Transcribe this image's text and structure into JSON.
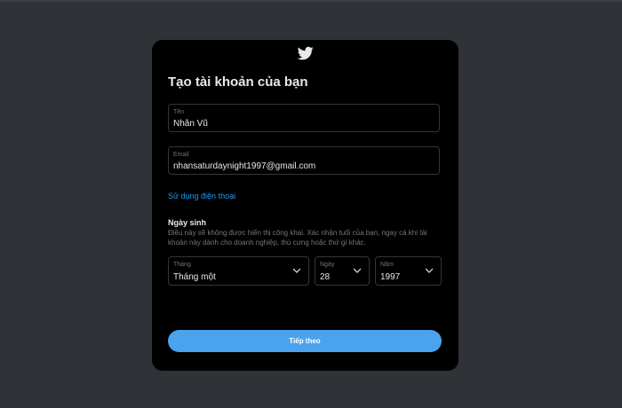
{
  "modal": {
    "logo_icon": "twitter-bird-icon",
    "title": "Tạo tài khoản của bạn"
  },
  "form": {
    "name": {
      "label": "Tên",
      "value": "Nhân Vũ"
    },
    "email": {
      "label": "Email",
      "value": "nhansaturdaynight1997@gmail.com"
    },
    "use_phone_link": "Sử dụng điện thoại",
    "dob": {
      "title": "Ngày sinh",
      "description": "Điều này sẽ không được hiển thị công khai.  Xác nhận tuổi của bạn, ngay cả khi tài khoản này dành cho doanh nghiệp, thú cưng hoặc thứ gì khác.",
      "month": {
        "label": "Tháng",
        "value": "Tháng một"
      },
      "day": {
        "label": "Ngày",
        "value": "28"
      },
      "year": {
        "label": "Năm",
        "value": "1997"
      }
    },
    "next_button": "Tiếp theo"
  },
  "colors": {
    "modal_bg": "#000000",
    "page_bg": "#2f3237",
    "accent": "#1d9bf0",
    "button_bg": "#4aa3ec"
  }
}
